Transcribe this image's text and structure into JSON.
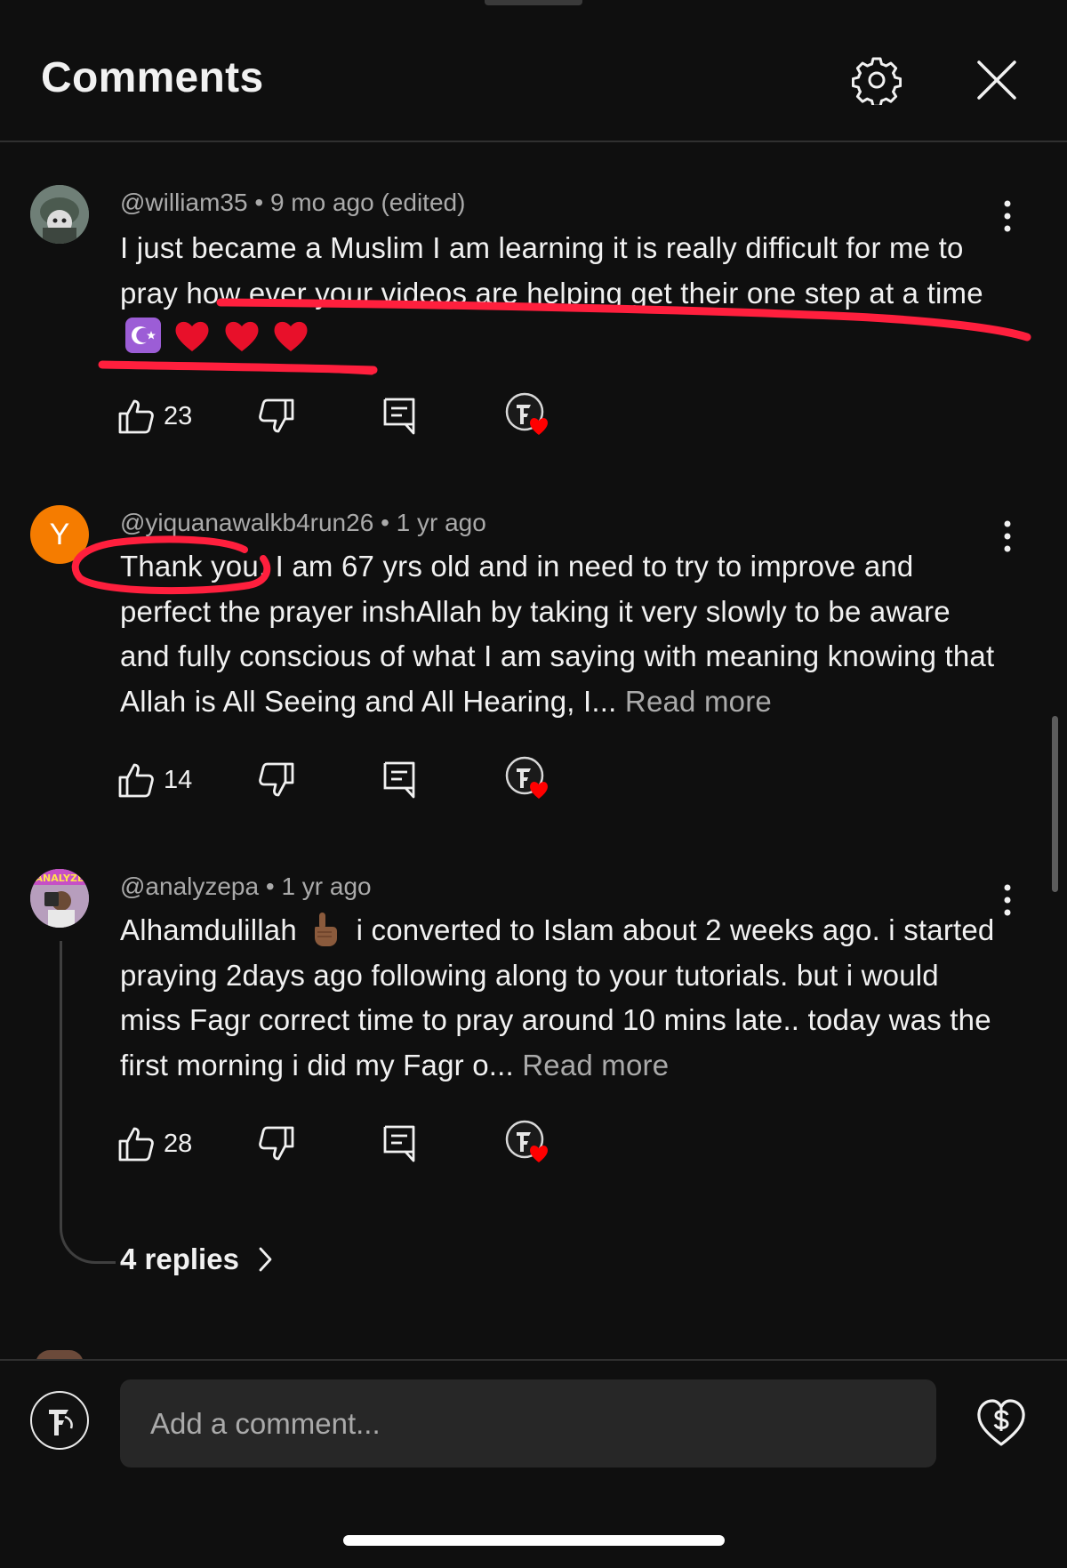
{
  "header": {
    "title": "Comments",
    "settings_icon": "gear-icon",
    "close_icon": "close-icon"
  },
  "comments": [
    {
      "handle": "@william35",
      "time": "9 mo ago (edited)",
      "text": "I just became a Muslim I am learning it is really difficult for me to pray how ever your videos are helping get their one step at a time",
      "emojis": [
        "star-and-crescent",
        "red-heart",
        "red-heart",
        "red-heart"
      ],
      "likes": "23",
      "avatar_icon": "soldier-avatar",
      "annotation": "red-underline"
    },
    {
      "handle": "@yiquanawalkb4run26",
      "time": "1 yr ago",
      "avatar_letter": "Y",
      "text": "Thank you, I am 67 yrs old and in need to try to improve and perfect the prayer inshAllah by taking it very slowly to be aware and fully conscious of what I am saying with meaning knowing that Allah is All Seeing and All Hearing, I...",
      "read_more": "Read more",
      "likes": "14",
      "avatar_color": "#f57c00",
      "annotation": "red-circle"
    },
    {
      "handle": "@analyzepa",
      "time": "1 yr ago",
      "avatar_text": "ANALYZE",
      "text_before_emoji": "Alhamdulillah",
      "emoji": "pointing-up-hand",
      "text": "i converted to Islam about 2 weeks ago. i started praying 2days ago following along to your tutorials. but i would miss Fagr correct time to pray around 10 mins late.. today was the first morning i did my Fagr o...",
      "read_more": "Read more",
      "likes": "28",
      "replies": "4 replies"
    }
  ],
  "footer": {
    "placeholder": "Add a comment...",
    "thanks_icon": "heart-dollar-icon"
  },
  "colors": {
    "background": "#0f0f0f",
    "text_primary": "#f1f1f1",
    "text_secondary": "#aaaaaa",
    "annotation_red": "#ff1f3d",
    "creator_heart": "#ff0000"
  }
}
